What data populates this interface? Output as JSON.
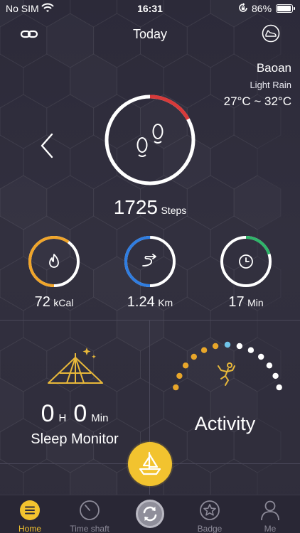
{
  "status_bar": {
    "carrier": "No SIM",
    "time": "16:31",
    "battery_text": "86%",
    "battery_level": 0.86,
    "icons": [
      "wifi-icon",
      "rotation-lock-icon",
      "battery-icon"
    ]
  },
  "nav": {
    "title": "Today",
    "left_icon": "link-icon",
    "right_icon": "shoe-icon"
  },
  "weather": {
    "city": "Baoan",
    "condition": "Light Rain",
    "temperature": "27°C ~ 32°C"
  },
  "steps": {
    "count": "1725",
    "unit": "Steps",
    "progress": 0.17,
    "icon": "footsteps-icon",
    "ring_color": "#d83a3a",
    "back_icon": "chevron-left-icon"
  },
  "metrics": [
    {
      "name": "calories",
      "value": "72",
      "unit": "kCal",
      "icon": "flame-icon",
      "color": "#f0a52a",
      "progress": 0.6
    },
    {
      "name": "distance",
      "value": "1.24",
      "unit": "Km",
      "icon": "route-icon",
      "color": "#2f7de1",
      "progress": 0.5
    },
    {
      "name": "duration",
      "value": "17",
      "unit": "Min",
      "icon": "clock-icon",
      "color": "#2fb56a",
      "progress": 0.2
    }
  ],
  "sleep": {
    "hours": "0",
    "hours_unit": "H",
    "minutes": "0",
    "minutes_unit": "Min",
    "label": "Sleep Monitor",
    "icon": "tent-icon"
  },
  "activity": {
    "label": "Activity",
    "icon": "runner-icon",
    "dots_filled": 6,
    "dots_current": 1,
    "dots_total": 13
  },
  "fab": {
    "icon": "sailboat-icon"
  },
  "tabs": [
    {
      "label": "Home",
      "icon": "home-icon",
      "active": true
    },
    {
      "label": "Time shaft",
      "icon": "timer-icon",
      "active": false
    },
    {
      "label": "",
      "icon": "sync-icon",
      "active": false
    },
    {
      "label": "Badge",
      "icon": "badge-star-icon",
      "active": false
    },
    {
      "label": "Me",
      "icon": "person-icon",
      "active": false
    }
  ],
  "colors": {
    "background": "#2f2d3c",
    "accent": "#f2c32f",
    "tab_inactive": "#8c8a98"
  }
}
